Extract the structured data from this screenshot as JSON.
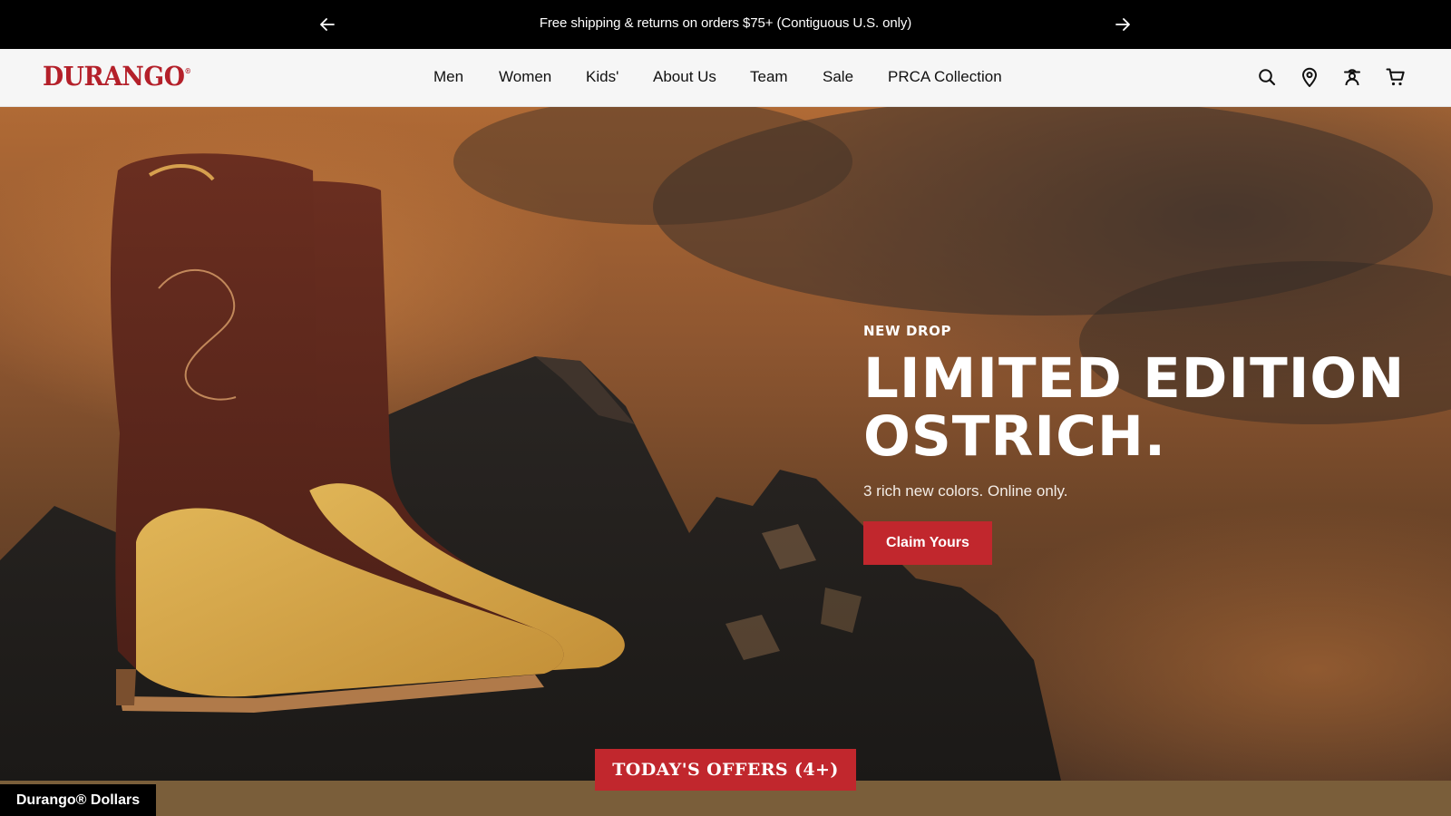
{
  "announcement": {
    "message": "Free shipping & returns on orders $75+ (Contiguous U.S. only)",
    "prev_icon": "arrow-left-icon",
    "next_icon": "arrow-right-icon"
  },
  "header": {
    "logo": "DURANGO",
    "logo_mark": "®",
    "nav": [
      {
        "label": "Men"
      },
      {
        "label": "Women"
      },
      {
        "label": "Kids'"
      },
      {
        "label": "About Us"
      },
      {
        "label": "Team"
      },
      {
        "label": "Sale"
      },
      {
        "label": "PRCA Collection"
      }
    ],
    "utility_icons": [
      "search-icon",
      "location-pin-icon",
      "account-icon",
      "cart-icon"
    ]
  },
  "hero": {
    "eyebrow": "NEW DROP",
    "headline_line1": "LIMITED EDITION",
    "headline_line2": "OSTRICH.",
    "subtext": "3 rich new colors. Online only.",
    "cta_label": "Claim Yours"
  },
  "offers_button": "TODAY'S OFFERS (4+)",
  "rewards_tab": "Durango® Dollars",
  "colors": {
    "brand_red": "#b4202a",
    "cta_red": "#c1272d",
    "announcement_bg": "#000000",
    "header_bg": "#f6f6f6",
    "strip_brown": "#7a5e3a"
  }
}
